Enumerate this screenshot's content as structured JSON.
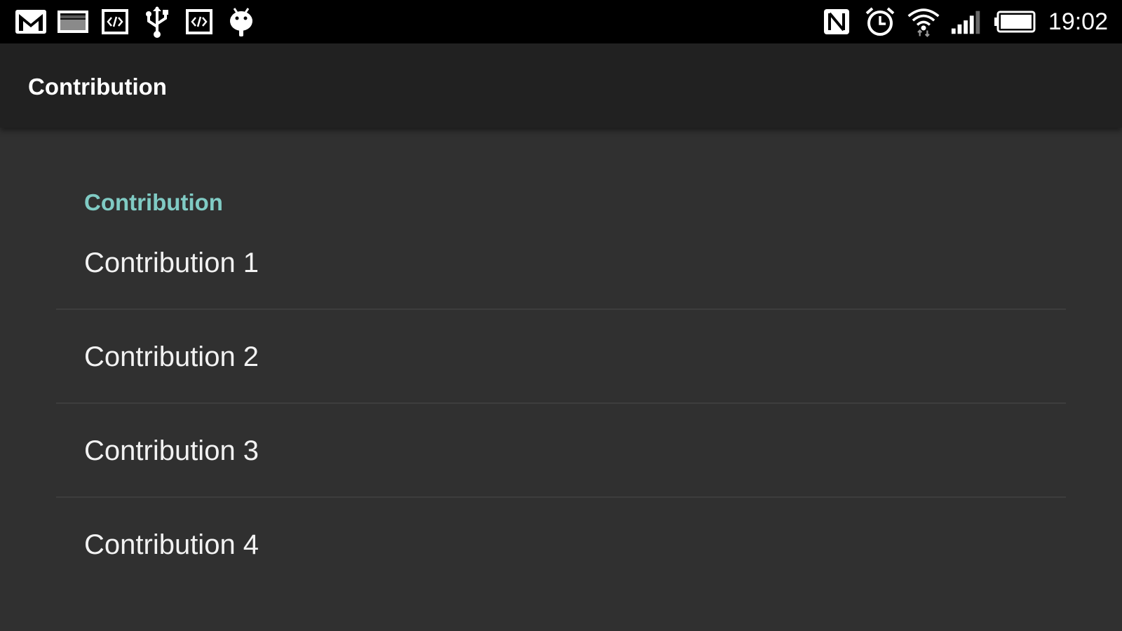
{
  "status_bar": {
    "left_icons": [
      "gmail-icon",
      "gallery-icon",
      "code-icon",
      "usb-icon",
      "code-icon",
      "android-icon"
    ],
    "right_icons": [
      "nfc-icon",
      "alarm-icon",
      "wifi-icon",
      "signal-icon",
      "battery-icon"
    ],
    "time": "19:02"
  },
  "action_bar": {
    "title": "Contribution"
  },
  "preferences": {
    "category_title": "Contribution",
    "items": [
      {
        "label": "Contribution 1"
      },
      {
        "label": "Contribution 2"
      },
      {
        "label": "Contribution 3"
      },
      {
        "label": "Contribution 4"
      }
    ]
  },
  "colors": {
    "status_bar_bg": "#000000",
    "action_bar_bg": "#212121",
    "content_bg": "#303030",
    "accent": "#80cbc4",
    "divider": "#3d3d3d"
  }
}
